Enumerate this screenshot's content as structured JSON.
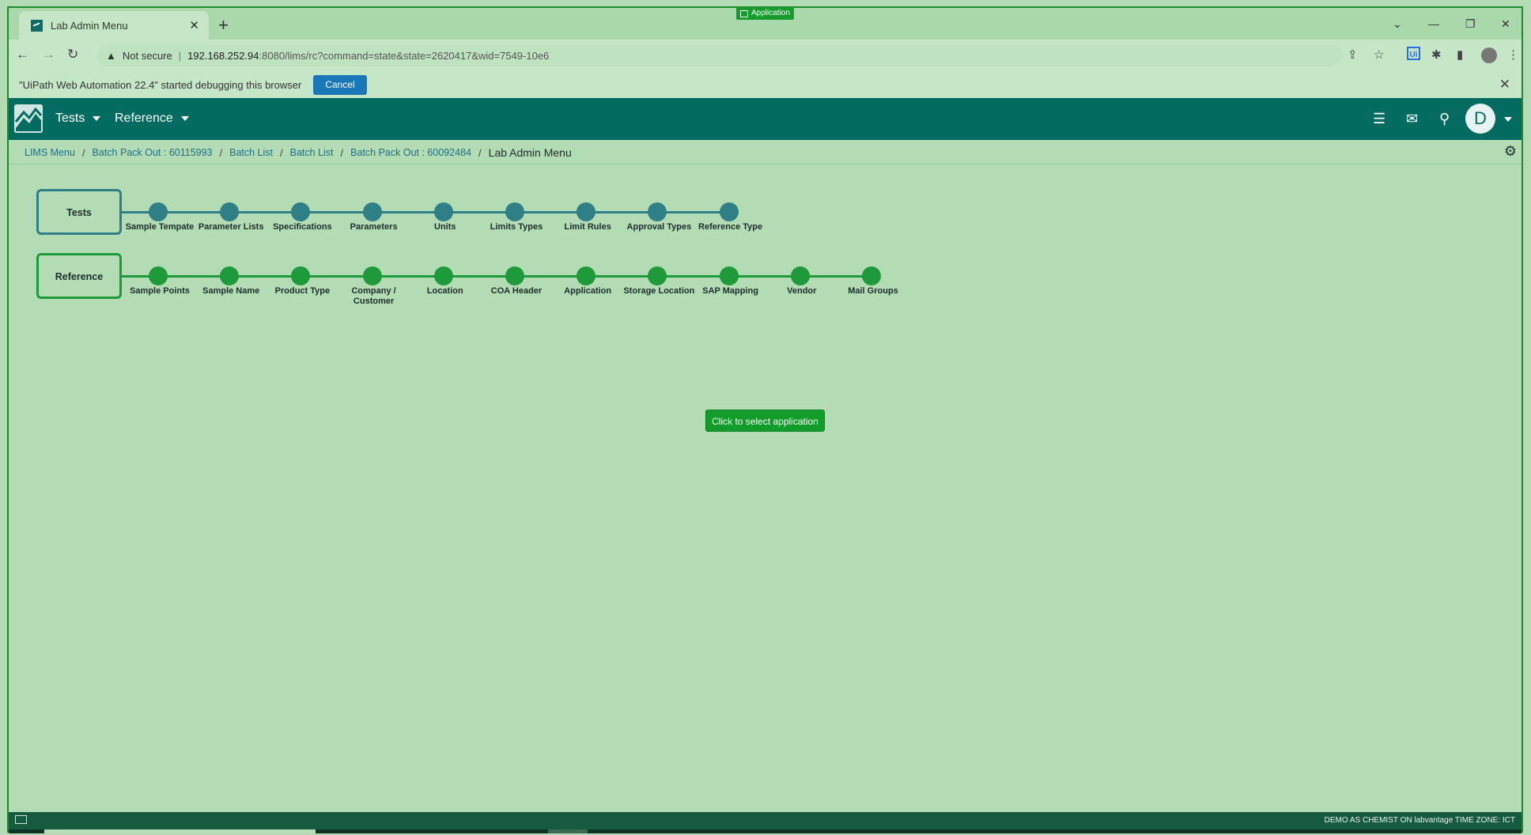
{
  "window": {
    "app_tag": "Application"
  },
  "browser": {
    "tab_title": "Lab Admin Menu",
    "security_label": "Not secure",
    "url_host": "192.168.252.94",
    "url_path": ":8080/lims/rc?command=state&state=2620417&wid=7549-10e6",
    "extension_label": "Ui"
  },
  "infobar": {
    "message": "\"UiPath Web Automation 22.4\" started debugging this browser",
    "cancel_label": "Cancel"
  },
  "header": {
    "menu_tests": "Tests",
    "menu_reference": "Reference",
    "avatar_initial": "D"
  },
  "breadcrumb": {
    "items": [
      "LIMS Menu",
      "Batch Pack Out : 60115993",
      "Batch List",
      "Batch List",
      "Batch Pack Out : 60092484"
    ],
    "current": "Lab Admin Menu"
  },
  "workflows": [
    {
      "name": "Tests",
      "color": "#2f7f86",
      "steps": [
        "Sample Tempate",
        "Parameter Lists",
        "Specifications",
        "Parameters",
        "Units",
        "Limits Types",
        "Limit Rules",
        "Approval Types",
        "Reference Type"
      ]
    },
    {
      "name": "Reference",
      "color": "#1f9a3a",
      "steps": [
        "Sample Points",
        "Sample Name",
        "Product Type",
        "Company / Customer",
        "Location",
        "COA Header",
        "Application",
        "Storage Location",
        "SAP Mapping",
        "Vendor",
        "Mail Groups"
      ]
    }
  ],
  "cta_label": "Click to select application",
  "footer": {
    "status": "DEMO AS CHEMIST ON labvantage TIME ZONE: ICT"
  }
}
